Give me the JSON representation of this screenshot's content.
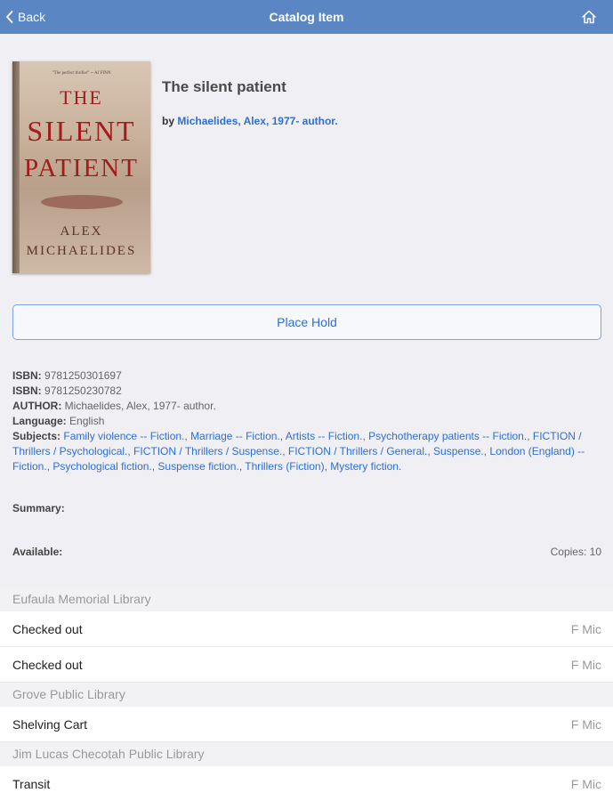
{
  "navbar": {
    "back_label": "Back",
    "title": "Catalog Item",
    "back_icon": "chevron-left-icon",
    "home_icon": "home-icon"
  },
  "cover": {
    "tagline": "\"The perfect thriller\" -- AJ FINN",
    "title_line1": "THE",
    "title_line2": "SILENT",
    "title_line3": "PATIENT",
    "author_line1": "ALEX",
    "author_line2": "MICHAELIDES"
  },
  "item": {
    "title": "The silent patient",
    "by_prefix": "by",
    "author": "Michaelides, Alex, 1977- author."
  },
  "hold_button": "Place Hold",
  "details": {
    "isbn_label": "ISBN:",
    "isbn1": "9781250301697",
    "isbn2": "9781250230782",
    "author_label": "AUTHOR:",
    "author": "Michaelides, Alex, 1977- author.",
    "language_label": "Language:",
    "language": "English",
    "subjects_label": "Subjects:",
    "subjects": [
      "Family violence -- Fiction.",
      "Marriage -- Fiction.",
      "Artists -- Fiction.",
      "Psychotherapy patients -- Fiction.",
      "FICTION / Thrillers / Psychological.",
      "FICTION / Thrillers / Suspense.",
      "FICTION / Thrillers / General.",
      "Suspense.",
      "London (England) -- Fiction.",
      "Psychological fiction.",
      "Suspense fiction.",
      "Thrillers (Fiction)",
      "Mystery fiction."
    ],
    "summary_label": "Summary:",
    "available_label": "Available:",
    "copies": "Copies: 10"
  },
  "holdings": [
    {
      "library": "Eufaula Memorial Library",
      "items": [
        {
          "status": "Checked out",
          "call_number": "F Mic"
        },
        {
          "status": "Checked out",
          "call_number": "F Mic"
        }
      ]
    },
    {
      "library": "Grove Public Library",
      "items": [
        {
          "status": "Shelving Cart",
          "call_number": "F Mic"
        }
      ]
    },
    {
      "library": "Jim Lucas Checotah Public Library",
      "items": [
        {
          "status": "Transit",
          "call_number": "F Mic"
        }
      ]
    }
  ]
}
